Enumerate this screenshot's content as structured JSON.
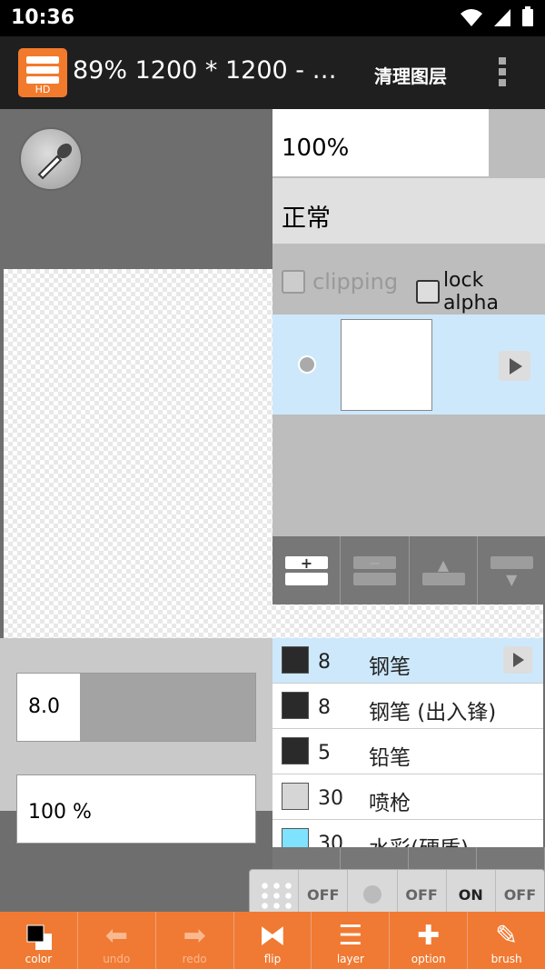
{
  "status_bar": {
    "time": "10:36"
  },
  "app_bar": {
    "icon_label": "HD",
    "title": "89% 1200 * 1200 - Un...",
    "action_label": "清理图层"
  },
  "layer_panel": {
    "opacity": "100%",
    "blend_mode": "正常",
    "clipping_label": "clipping",
    "lock_alpha_label": "lock alpha"
  },
  "brush_panel": {
    "size_value": "8.0",
    "alpha_value": "100 %"
  },
  "brush_list": [
    {
      "size": "8",
      "name": "钢笔",
      "color": "#2a2a2a"
    },
    {
      "size": "8",
      "name": "钢笔 (出入锋)",
      "color": "#2a2a2a"
    },
    {
      "size": "5",
      "name": "铅笔",
      "color": "#2a2a2a"
    },
    {
      "size": "30",
      "name": "喷枪",
      "color": "#d6d6d6"
    },
    {
      "size": "30",
      "name": "水彩(硬质)",
      "color": "#7fe3ff"
    }
  ],
  "float_toolbar": {
    "btn2": "OFF",
    "btn4": "OFF",
    "btn5": "ON",
    "btn6": "OFF"
  },
  "bottom_bar": {
    "color": "color",
    "undo": "undo",
    "redo": "redo",
    "flip": "flip",
    "layer": "layer",
    "option": "option",
    "brush": "brush"
  }
}
